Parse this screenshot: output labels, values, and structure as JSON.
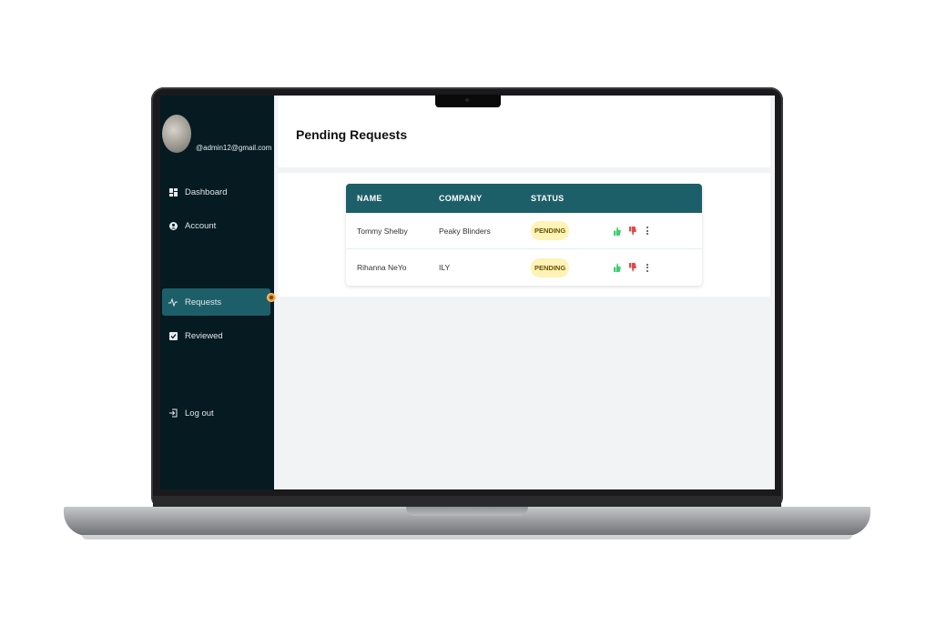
{
  "user": {
    "email": "@admin12@gmail.com"
  },
  "sidebar": {
    "items": [
      {
        "label": "Dashboard",
        "icon": "dashboard-icon"
      },
      {
        "label": "Account",
        "icon": "user-circle-icon"
      },
      {
        "label": "Requests",
        "icon": "activity-icon",
        "active": true
      },
      {
        "label": "Reviewed",
        "icon": "checkbox-icon"
      },
      {
        "label": "Log out",
        "icon": "logout-icon"
      }
    ]
  },
  "header": {
    "title": "Pending Requests"
  },
  "table": {
    "columns": [
      "NAME",
      "COMPANY",
      "STATUS"
    ],
    "rows": [
      {
        "name": "Tommy Shelby",
        "company": "Peaky Blinders",
        "status": "PENDING"
      },
      {
        "name": "Rihanna NeYo",
        "company": "ILY",
        "status": "PENDING"
      }
    ]
  },
  "colors": {
    "sidebar_bg": "#061a22",
    "accent": "#1d5f69",
    "approve": "#3ecf6e",
    "reject": "#e0494e",
    "pending_badge": "#fff3b8"
  }
}
